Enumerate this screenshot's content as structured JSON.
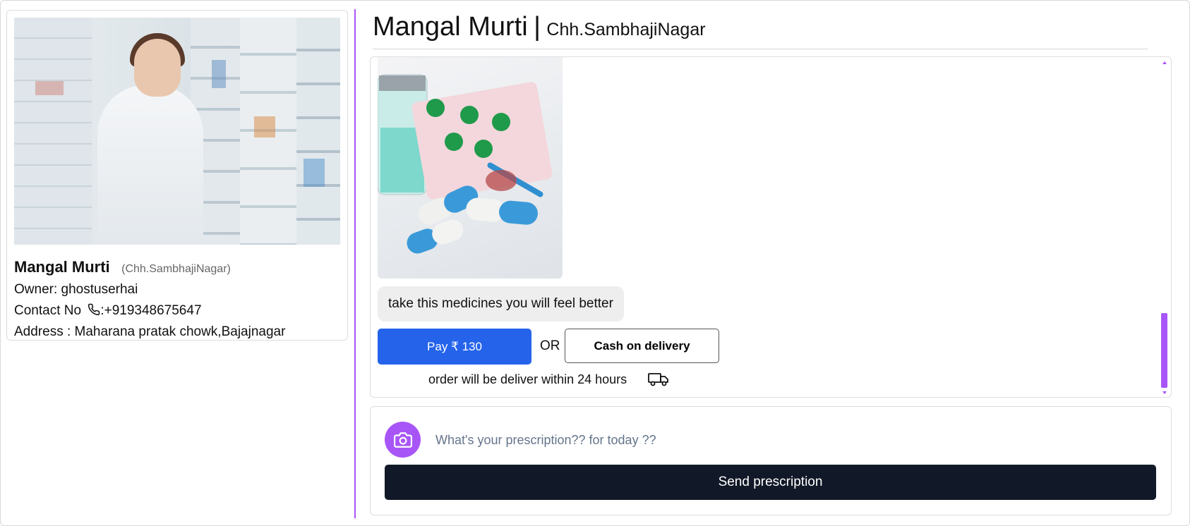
{
  "store": {
    "name": "Mangal Murti",
    "city_paren": "(Chh.SambhajiNagar)",
    "owner": "Owner: ghostuserhai",
    "contact_prefix": "Contact No",
    "contact_number": ":+919348675647",
    "address": "Address : Maharana pratak chowk,Bajajnagar"
  },
  "chat": {
    "title": "Mangal Murti",
    "separator": "|",
    "city": "Chh.SambhajiNagar",
    "message": "take this medicines you will feel better",
    "pay_label": "Pay ₹ 130",
    "or_label": "OR",
    "cod_label": "Cash on delivery",
    "delivery_note": "order will be deliver within 24 hours"
  },
  "compose": {
    "placeholder": "What's your prescription?? for today ??",
    "send_label": "Send prescription"
  },
  "colors": {
    "accent_purple": "#a855f7",
    "pay_blue": "#2563eb",
    "send_dark": "#111827"
  },
  "icons": [
    "phone-icon",
    "truck-icon",
    "camera-icon"
  ]
}
